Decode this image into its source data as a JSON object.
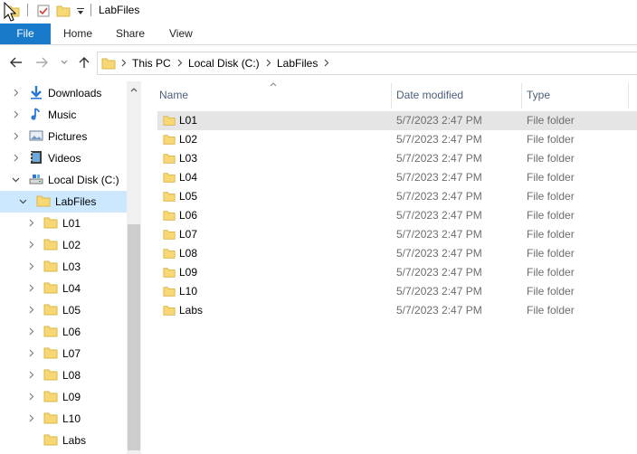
{
  "window": {
    "title": "LabFiles"
  },
  "ribbon": {
    "tabs": [
      {
        "label": "File"
      },
      {
        "label": "Home"
      },
      {
        "label": "Share"
      },
      {
        "label": "View"
      }
    ]
  },
  "address": {
    "crumbs": [
      "This PC",
      "Local Disk (C:)",
      "LabFiles"
    ]
  },
  "nav": {
    "items": [
      {
        "label": "Downloads",
        "icon": "downloads-icon"
      },
      {
        "label": "Music",
        "icon": "music-icon"
      },
      {
        "label": "Pictures",
        "icon": "pictures-icon"
      },
      {
        "label": "Videos",
        "icon": "videos-icon"
      },
      {
        "label": "Local Disk (C:)",
        "icon": "drive-icon"
      },
      {
        "label": "LabFiles",
        "icon": "folder-icon",
        "selected": true
      },
      {
        "label": "L01",
        "icon": "folder-icon"
      },
      {
        "label": "L02",
        "icon": "folder-icon"
      },
      {
        "label": "L03",
        "icon": "folder-icon"
      },
      {
        "label": "L04",
        "icon": "folder-icon"
      },
      {
        "label": "L05",
        "icon": "folder-icon"
      },
      {
        "label": "L06",
        "icon": "folder-icon"
      },
      {
        "label": "L07",
        "icon": "folder-icon"
      },
      {
        "label": "L08",
        "icon": "folder-icon"
      },
      {
        "label": "L09",
        "icon": "folder-icon"
      },
      {
        "label": "L10",
        "icon": "folder-icon"
      },
      {
        "label": "Labs",
        "icon": "folder-icon"
      }
    ]
  },
  "columns": {
    "name": "Name",
    "date": "Date modified",
    "type": "Type"
  },
  "files": [
    {
      "name": "L01",
      "date": "5/7/2023 2:47 PM",
      "type": "File folder",
      "hover": true
    },
    {
      "name": "L02",
      "date": "5/7/2023 2:47 PM",
      "type": "File folder"
    },
    {
      "name": "L03",
      "date": "5/7/2023 2:47 PM",
      "type": "File folder"
    },
    {
      "name": "L04",
      "date": "5/7/2023 2:47 PM",
      "type": "File folder"
    },
    {
      "name": "L05",
      "date": "5/7/2023 2:47 PM",
      "type": "File folder"
    },
    {
      "name": "L06",
      "date": "5/7/2023 2:47 PM",
      "type": "File folder"
    },
    {
      "name": "L07",
      "date": "5/7/2023 2:47 PM",
      "type": "File folder"
    },
    {
      "name": "L08",
      "date": "5/7/2023 2:47 PM",
      "type": "File folder"
    },
    {
      "name": "L09",
      "date": "5/7/2023 2:47 PM",
      "type": "File folder"
    },
    {
      "name": "L10",
      "date": "5/7/2023 2:47 PM",
      "type": "File folder"
    },
    {
      "name": "Labs",
      "date": "5/7/2023 2:47 PM",
      "type": "File folder"
    }
  ],
  "colors": {
    "accent": "#1979ca",
    "selected_bg": "#cce8ff",
    "hover_bg": "#e5e5e5",
    "folder": "#f8d775"
  }
}
